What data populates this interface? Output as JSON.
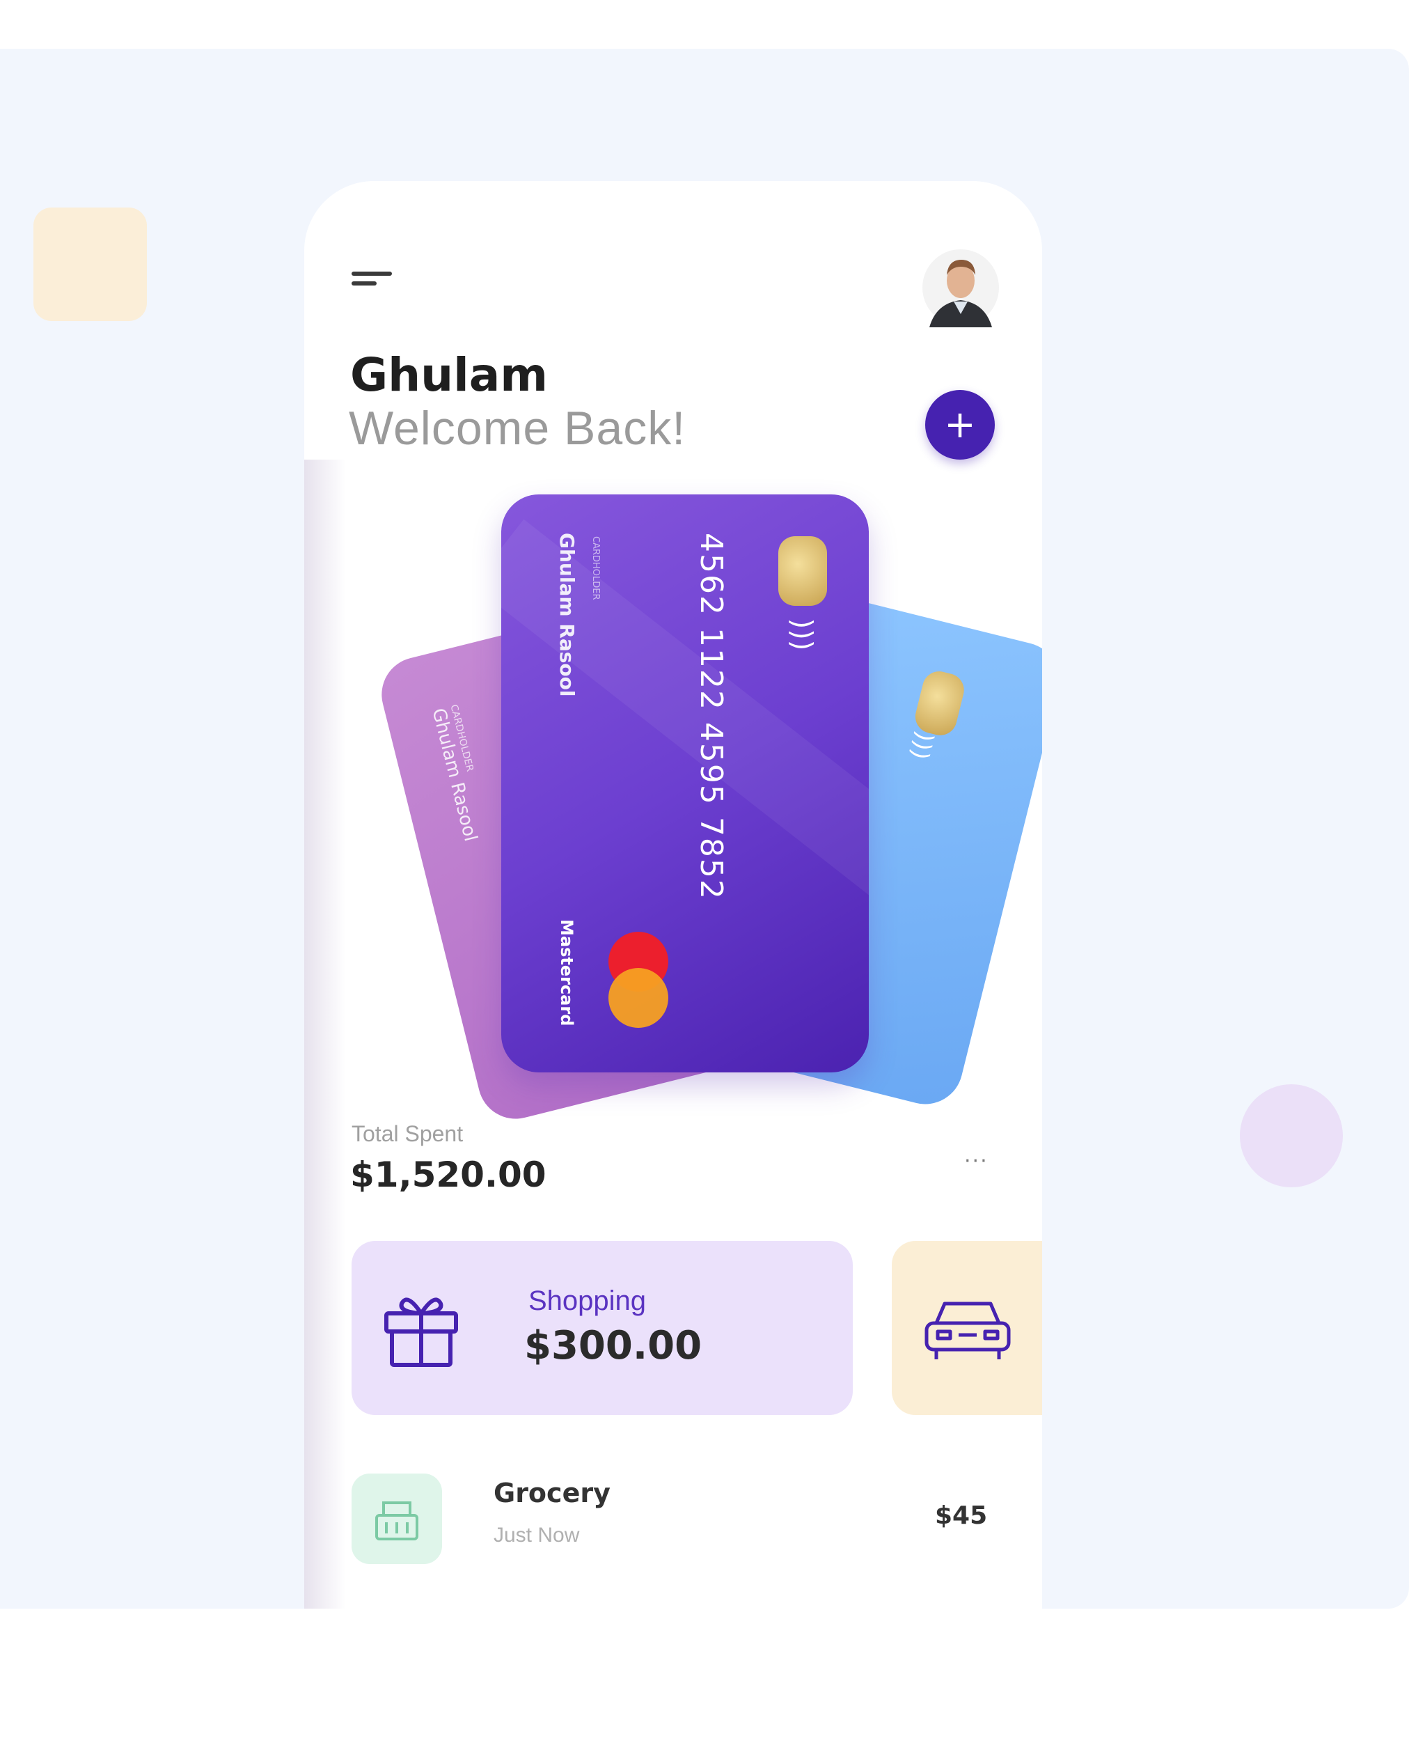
{
  "header": {
    "user_name": "Ghulam",
    "welcome_text": "Welcome Back!",
    "add_button_label": "+"
  },
  "cards": {
    "main": {
      "number": "4562 1122 4595 7852",
      "holder_label": "CARDHOLDER",
      "holder_name": "Ghulam Rasool",
      "brand": "Mastercard"
    },
    "back_left": {
      "holder_label": "CARDHOLDER",
      "holder_name": "Ghulam Rasool"
    }
  },
  "summary": {
    "total_label": "Total Spent",
    "total_amount": "$1,520.00",
    "more_icon": "···"
  },
  "categories": [
    {
      "label": "Shopping",
      "amount": "$300.00",
      "icon": "gift-icon"
    },
    {
      "icon": "car-icon"
    }
  ],
  "transactions": [
    {
      "name": "Grocery",
      "time": "Just Now",
      "amount": "$45",
      "icon": "grocery-basket-icon"
    }
  ],
  "colors": {
    "accent": "#4622b0",
    "card_main": "#6c3fd0",
    "card_pink": "#b06cc6",
    "card_blue": "#6aa8f3",
    "shopping_bg": "#ebe1fb",
    "car_bg": "#fbeed5",
    "grocery_bg": "#dff5ea",
    "page_bg": "#f2f6fd"
  }
}
